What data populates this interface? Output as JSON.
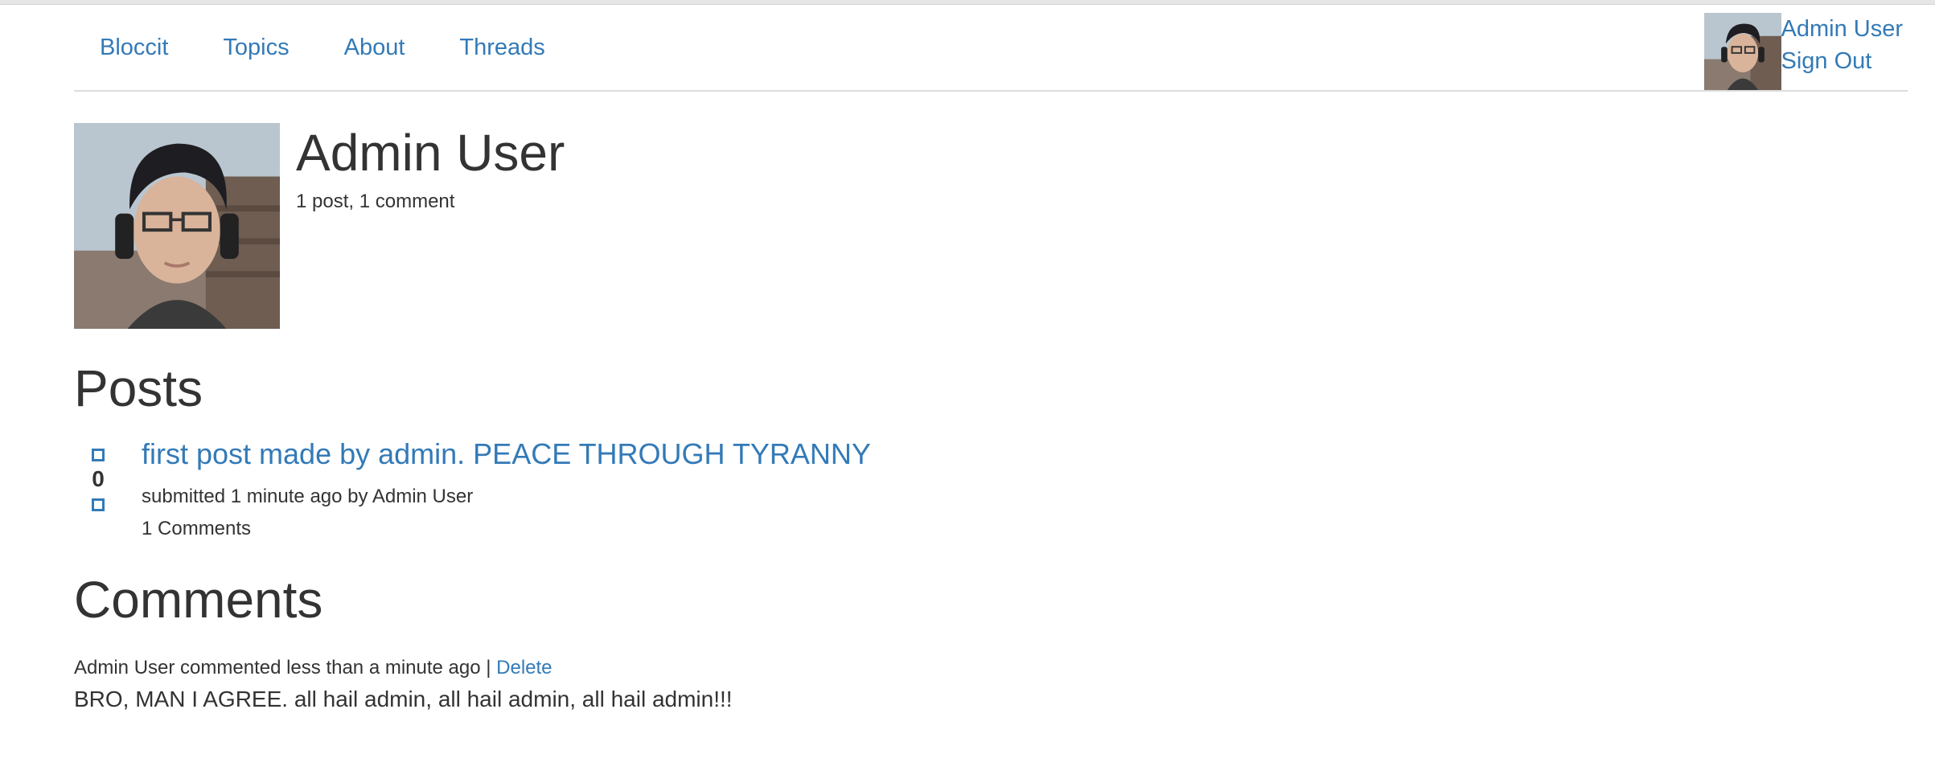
{
  "nav": {
    "links": [
      "Bloccit",
      "Topics",
      "About",
      "Threads"
    ],
    "user_name": "Admin User",
    "sign_out": "Sign Out"
  },
  "profile": {
    "name": "Admin User",
    "stats": "1 post, 1 comment"
  },
  "posts_section": {
    "heading": "Posts",
    "items": [
      {
        "title": "first post made by admin. PEACE THROUGH TYRANNY",
        "votes": "0",
        "meta": "submitted 1 minute ago by Admin User",
        "comments": "1 Comments"
      }
    ]
  },
  "comments_section": {
    "heading": "Comments",
    "items": [
      {
        "meta": "Admin User commented less than a minute ago |",
        "delete_label": "Delete",
        "body": "BRO, MAN I AGREE. all hail admin, all hail admin, all hail admin!!!"
      }
    ]
  },
  "colors": {
    "link": "#337ab7",
    "text": "#333333"
  }
}
